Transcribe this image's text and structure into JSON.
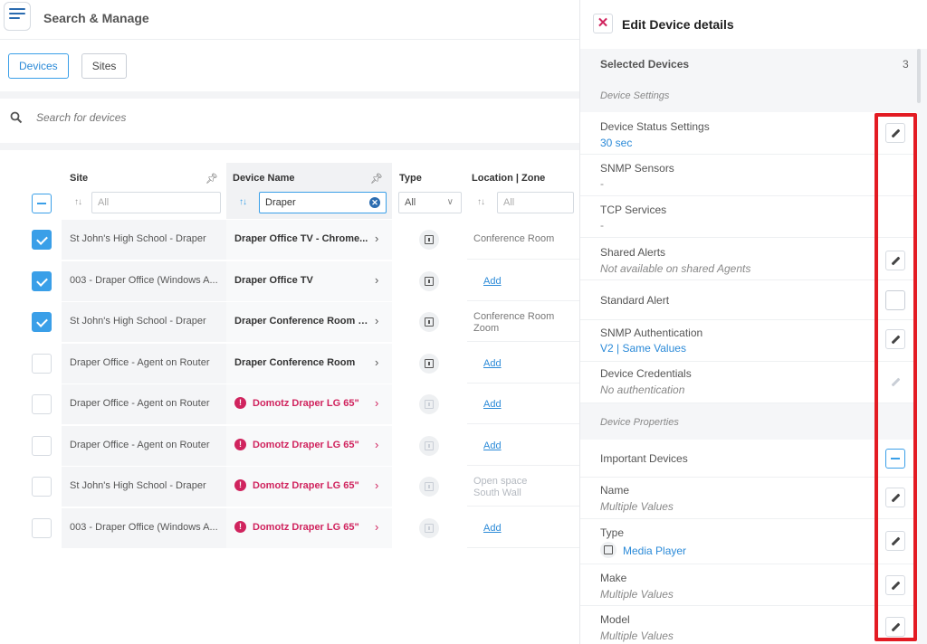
{
  "app": {
    "title": "Search & Manage"
  },
  "tabs": [
    {
      "label": "Devices",
      "active": true
    },
    {
      "label": "Sites",
      "active": false
    }
  ],
  "search": {
    "placeholder": "Search for devices"
  },
  "table": {
    "columns": {
      "site": "Site",
      "device_name": "Device Name",
      "type": "Type",
      "location": "Location | Zone"
    },
    "filters": {
      "site_placeholder": "All",
      "device_name_value": "Draper",
      "type_value": "All",
      "location_placeholder": "All"
    },
    "rows": [
      {
        "checked": true,
        "site": "St John's High School - Draper",
        "device": "Draper Office TV - Chrome...",
        "alert": false,
        "type_faded": false,
        "location": "Conference Room",
        "location_faded": false,
        "add": false
      },
      {
        "checked": true,
        "site": "003 - Draper Office (Windows A...",
        "device": "Draper Office TV",
        "alert": false,
        "type_faded": false,
        "location": "",
        "location_faded": false,
        "add": true
      },
      {
        "checked": true,
        "site": "St John's High School - Draper",
        "device": "Draper Conference Room - ...",
        "alert": false,
        "type_faded": false,
        "location": "Conference Room\nZoom",
        "location_faded": false,
        "add": false
      },
      {
        "checked": false,
        "site": "Draper Office - Agent on Router",
        "device": "Draper Conference Room",
        "alert": false,
        "type_faded": false,
        "location": "",
        "location_faded": false,
        "add": true
      },
      {
        "checked": false,
        "site": "Draper Office - Agent on Router",
        "device": "Domotz Draper LG 65\"",
        "alert": true,
        "type_faded": true,
        "location": "",
        "location_faded": false,
        "add": true
      },
      {
        "checked": false,
        "site": "Draper Office - Agent on Router",
        "device": "Domotz Draper LG 65\"",
        "alert": true,
        "type_faded": true,
        "location": "",
        "location_faded": false,
        "add": true
      },
      {
        "checked": false,
        "site": "St John's High School - Draper",
        "device": "Domotz Draper LG 65\"",
        "alert": true,
        "type_faded": true,
        "location": "Open space\nSouth Wall",
        "location_faded": true,
        "add": false
      },
      {
        "checked": false,
        "site": "003 - Draper Office (Windows A...",
        "device": "Domotz Draper LG 65\"",
        "alert": true,
        "type_faded": true,
        "location": "",
        "location_faded": false,
        "add": true
      }
    ],
    "add_label": "Add",
    "alert_glyph": "!"
  },
  "panel": {
    "title": "Edit Device details",
    "selected_label": "Selected Devices",
    "selected_count": "3",
    "sections": {
      "settings": "Device Settings",
      "properties": "Device Properties"
    },
    "items": {
      "status": {
        "label": "Device Status Settings",
        "value": "30 sec"
      },
      "snmp": {
        "label": "SNMP Sensors",
        "value": "-"
      },
      "tcp": {
        "label": "TCP Services",
        "value": "-"
      },
      "shared": {
        "label": "Shared Alerts",
        "value": "Not available on shared Agents"
      },
      "standard": {
        "label": "Standard Alert"
      },
      "snmpauth": {
        "label": "SNMP Authentication",
        "value": "V2 | Same Values"
      },
      "creds": {
        "label": "Device Credentials",
        "value": "No authentication"
      },
      "important": {
        "label": "Important Devices"
      },
      "name": {
        "label": "Name",
        "value": "Multiple Values"
      },
      "type": {
        "label": "Type",
        "value": "Media Player"
      },
      "make": {
        "label": "Make",
        "value": "Multiple Values"
      },
      "model": {
        "label": "Model",
        "value": "Multiple Values"
      }
    }
  },
  "colors": {
    "accent": "#3a9fe8",
    "alert": "#d0245e",
    "highlight": "#e31b23"
  },
  "icons": {
    "menu": "menu-icon",
    "search": "search-icon",
    "pin": "pin-icon",
    "sort": "sort-icon",
    "clear": "clear-icon",
    "close": "close-icon",
    "edit": "pencil-icon",
    "media_player": "media-player-icon"
  }
}
